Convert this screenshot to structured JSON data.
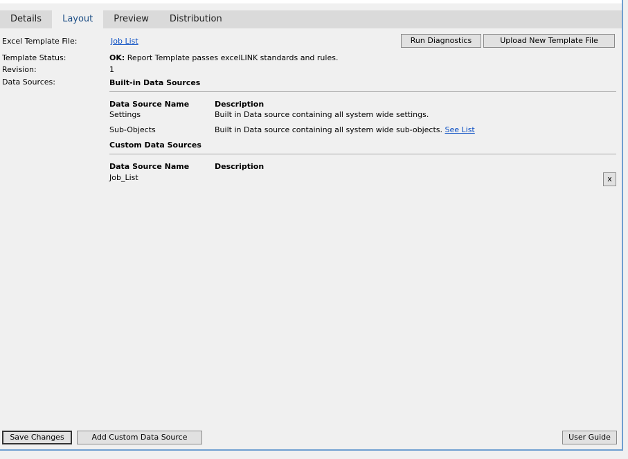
{
  "tabs": [
    {
      "label": "Details"
    },
    {
      "label": "Layout"
    },
    {
      "label": "Preview"
    },
    {
      "label": "Distribution"
    }
  ],
  "fields": {
    "template_file_label": "Excel Template File:",
    "template_file_link": "Job List",
    "status_label": "Template Status:",
    "status_ok": "OK:",
    "status_text": "Report Template passes excelLINK standards and rules.",
    "revision_label": "Revision:",
    "revision_value": "1",
    "data_sources_label": "Data Sources:"
  },
  "actions": {
    "run_diagnostics": "Run Diagnostics",
    "upload_template": "Upload New Template File"
  },
  "builtin": {
    "heading": "Built-in Data Sources",
    "col_name": "Data Source Name",
    "col_desc": "Description",
    "rows": [
      {
        "name": "Settings",
        "description": "Built in Data source containing all system wide settings.",
        "link": ""
      },
      {
        "name": "Sub-Objects",
        "description": "Built in Data source containing all system wide sub-objects.",
        "link": "See List"
      }
    ]
  },
  "custom": {
    "heading": "Custom Data Sources",
    "col_name": "Data Source Name",
    "col_desc": "Description",
    "rows": [
      {
        "name": "Job_List",
        "remove": "x"
      }
    ]
  },
  "footer": {
    "save": "Save Changes",
    "add_custom": "Add Custom Data Source",
    "user_guide": "User Guide"
  }
}
